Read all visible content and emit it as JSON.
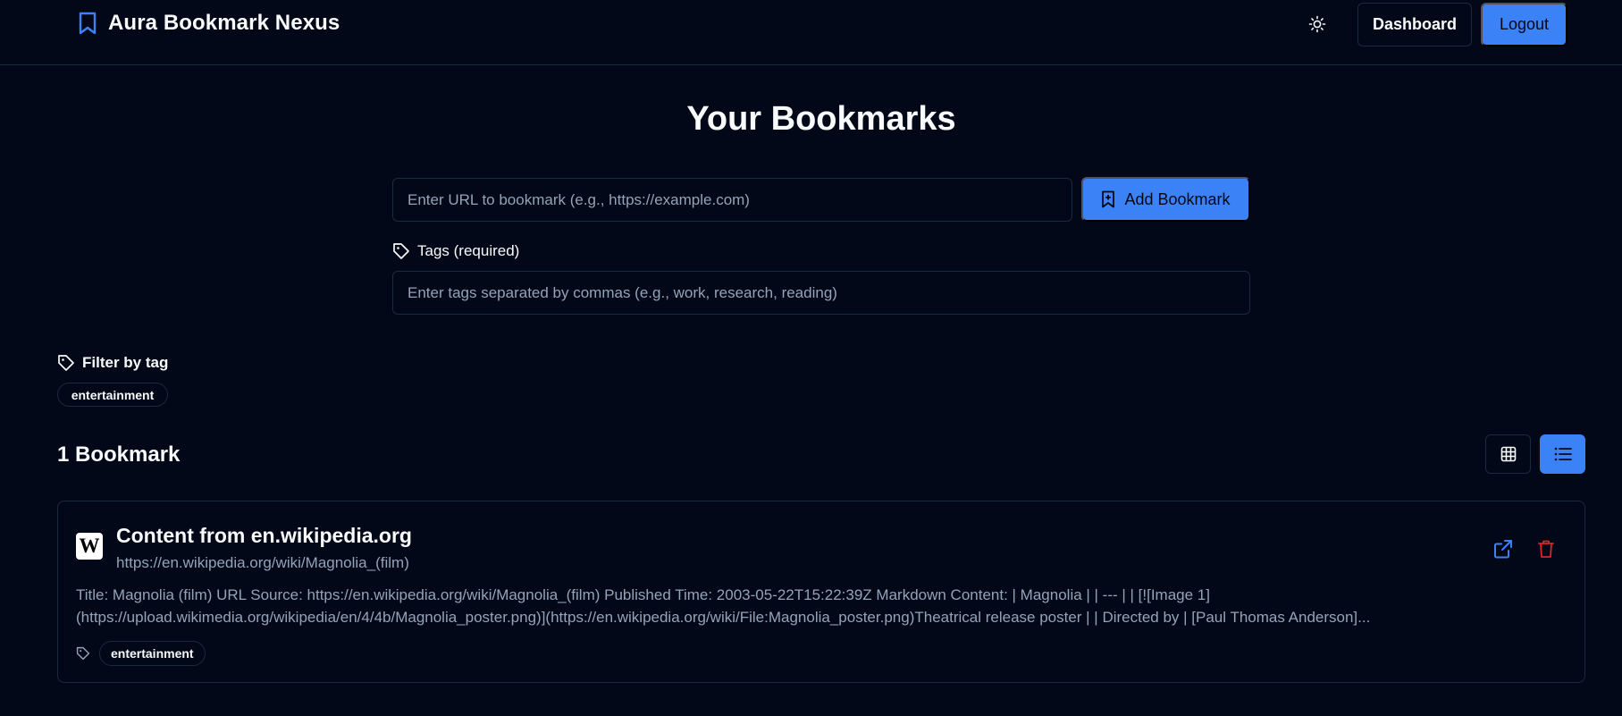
{
  "header": {
    "brand_title": "Aura Bookmark Nexus",
    "dashboard_label": "Dashboard",
    "logout_label": "Logout"
  },
  "main": {
    "title": "Your Bookmarks",
    "url_placeholder": "Enter URL to bookmark (e.g., https://example.com)",
    "add_button_label": "Add Bookmark",
    "tags_label": "Tags (required)",
    "tags_placeholder": "Enter tags separated by commas (e.g., work, research, reading)"
  },
  "filter": {
    "label": "Filter by tag",
    "tags": [
      "entertainment"
    ]
  },
  "list": {
    "count_label": "1 Bookmark",
    "view_mode": "list"
  },
  "bookmarks": [
    {
      "favicon": "W",
      "title": "Content from en.wikipedia.org",
      "url": "https://en.wikipedia.org/wiki/Magnolia_(film)",
      "description": "Title: Magnolia (film) URL Source: https://en.wikipedia.org/wiki/Magnolia_(film) Published Time: 2003-05-22T15:22:39Z Markdown Content: | Magnolia | | --- | | [![Image 1](https://upload.wikimedia.org/wikipedia/en/4/4b/Magnolia_poster.png)](https://en.wikipedia.org/wiki/File:Magnolia_poster.png)Theatrical release poster | | Directed by | [Paul Thomas Anderson]...",
      "tags": [
        "entertainment"
      ]
    }
  ],
  "colors": {
    "background": "#020817",
    "border": "#1e293b",
    "accent": "#3b82f6",
    "muted_text": "#94a3b8",
    "danger": "#dc2626"
  },
  "icons": {
    "brand": "bookmark-icon",
    "theme": "sun-icon",
    "add": "bookmark-plus-icon",
    "tag": "tag-icon",
    "grid_view": "grid-icon",
    "list_view": "list-icon",
    "open": "external-link-icon",
    "delete": "trash-icon"
  }
}
